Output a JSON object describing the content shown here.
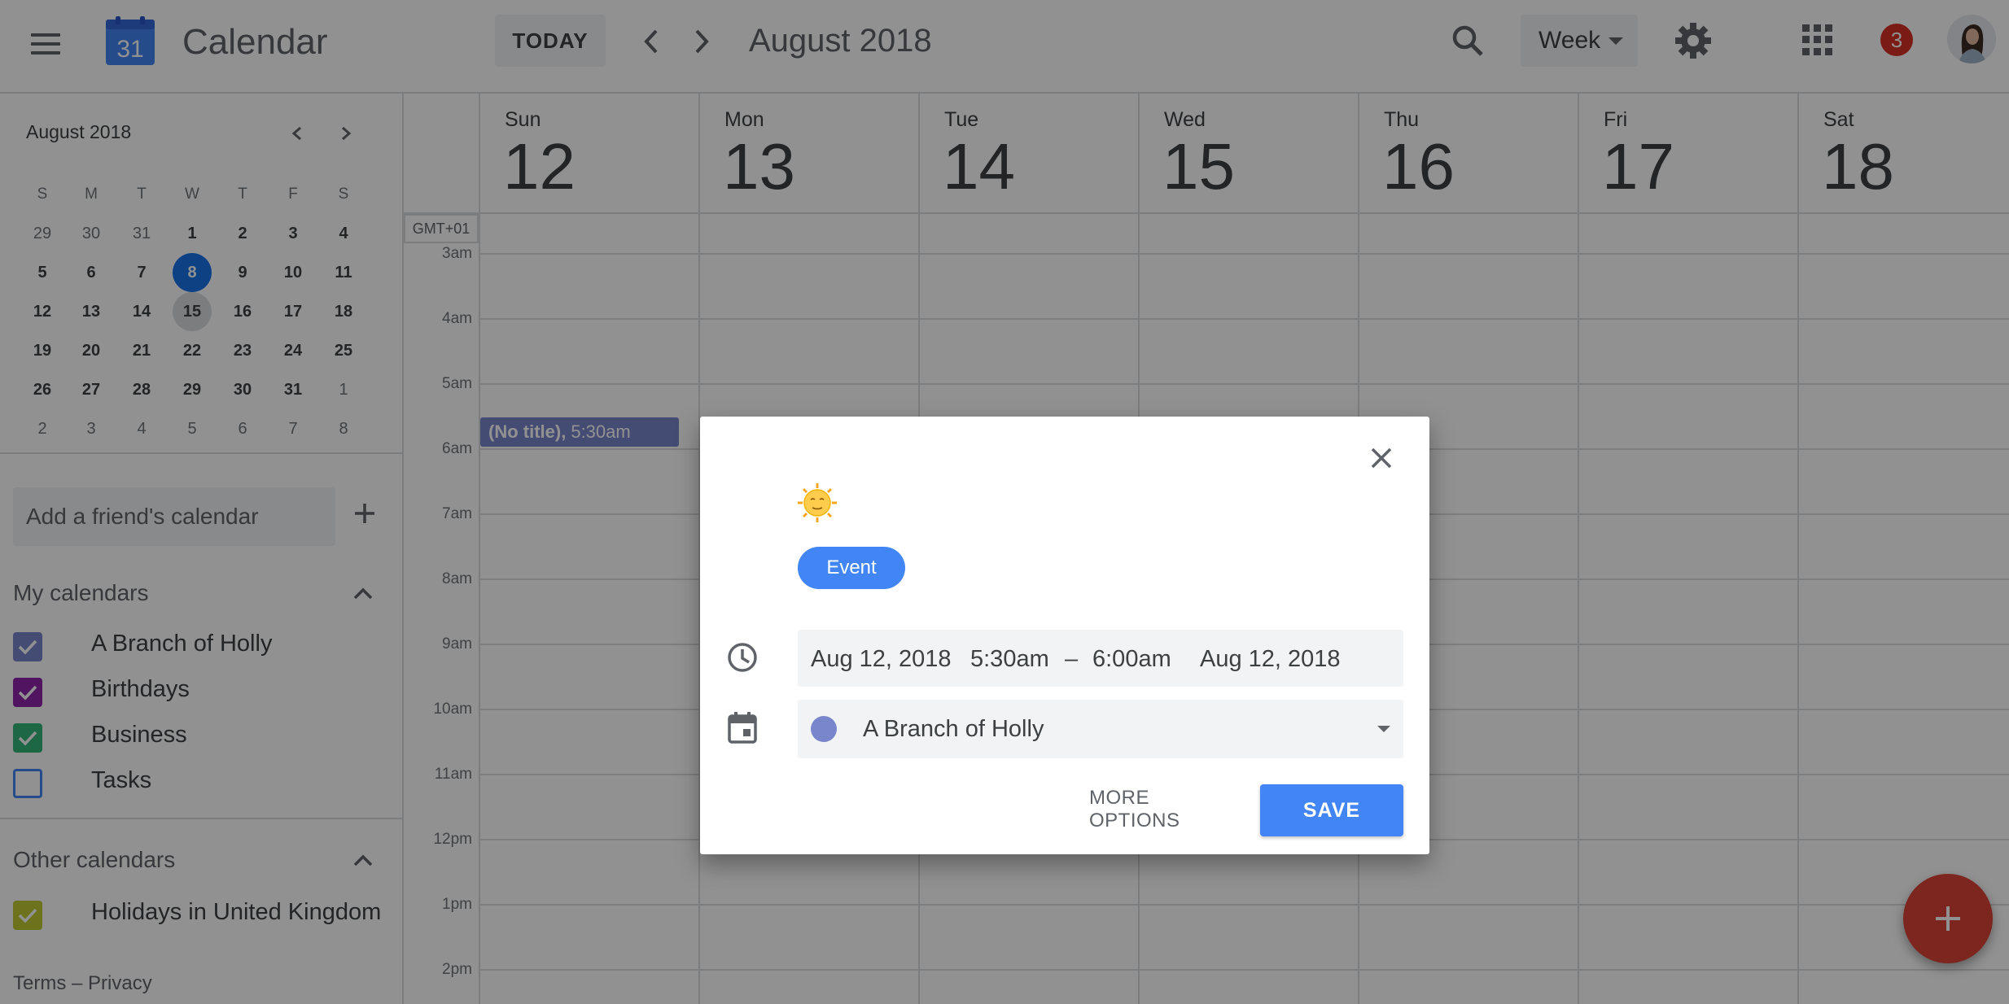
{
  "header": {
    "logo_day": "31",
    "app_title": "Calendar",
    "today_label": "TODAY",
    "period_title": "August 2018",
    "view_label": "Week",
    "notification_count": "3"
  },
  "mini_calendar": {
    "title": "August 2018",
    "weekday_heads": [
      "S",
      "M",
      "T",
      "W",
      "T",
      "F",
      "S"
    ],
    "weeks": [
      [
        "29",
        "30",
        "31",
        "1",
        "2",
        "3",
        "4"
      ],
      [
        "5",
        "6",
        "7",
        "8",
        "9",
        "10",
        "11"
      ],
      [
        "12",
        "13",
        "14",
        "15",
        "16",
        "17",
        "18"
      ],
      [
        "19",
        "20",
        "21",
        "22",
        "23",
        "24",
        "25"
      ],
      [
        "26",
        "27",
        "28",
        "29",
        "30",
        "31",
        "1"
      ],
      [
        "2",
        "3",
        "4",
        "5",
        "6",
        "7",
        "8"
      ]
    ],
    "today_day": "8",
    "selected_day": "15"
  },
  "sidebar": {
    "friend_placeholder": "Add a friend's calendar",
    "my_calendars_title": "My calendars",
    "my_calendars": [
      {
        "label": "A Branch of Holly",
        "color": "#7986cb",
        "checked": true
      },
      {
        "label": "Birthdays",
        "color": "#8e24aa",
        "checked": true
      },
      {
        "label": "Business",
        "color": "#33b679",
        "checked": true
      },
      {
        "label": "Tasks",
        "color": "#4285f4",
        "checked": false
      }
    ],
    "other_calendars_title": "Other calendars",
    "other_calendars": [
      {
        "label": "Holidays in United Kingdom",
        "color": "#c0ca33",
        "checked": true
      }
    ],
    "footer": "Terms – Privacy"
  },
  "week": {
    "timezone": "GMT+01",
    "days": [
      {
        "name": "Sun",
        "num": "12"
      },
      {
        "name": "Mon",
        "num": "13"
      },
      {
        "name": "Tue",
        "num": "14"
      },
      {
        "name": "Wed",
        "num": "15"
      },
      {
        "name": "Thu",
        "num": "16"
      },
      {
        "name": "Fri",
        "num": "17"
      },
      {
        "name": "Sat",
        "num": "18"
      }
    ],
    "hours": [
      "3am",
      "4am",
      "5am",
      "6am",
      "7am",
      "8am",
      "9am",
      "10am",
      "11am",
      "12pm",
      "1pm",
      "2pm"
    ],
    "event": {
      "title": "(No title),",
      "time": "5:30am"
    }
  },
  "dialog": {
    "chip_label": "Event",
    "start_date": "Aug 12, 2018",
    "start_time": "5:30am",
    "dash": "–",
    "end_time": "6:00am",
    "end_date": "Aug 12, 2018",
    "calendar_name": "A Branch of Holly",
    "calendar_color": "#7986cb",
    "more_options_label": "MORE OPTIONS",
    "save_label": "SAVE"
  },
  "colors": {
    "accent": "#4285f4",
    "fab": "#db4437",
    "badge": "#d93025",
    "overlay": "rgba(0,0,0,0.43)"
  },
  "icons": [
    "menu-icon",
    "calendar-logo-icon",
    "chevron-left-icon",
    "chevron-right-icon",
    "search-icon",
    "caret-down-icon",
    "gear-icon",
    "apps-grid-icon",
    "plus-icon",
    "chevron-up-icon",
    "check-icon",
    "close-icon",
    "sun-emoji-icon",
    "clock-icon",
    "calendar-icon"
  ]
}
